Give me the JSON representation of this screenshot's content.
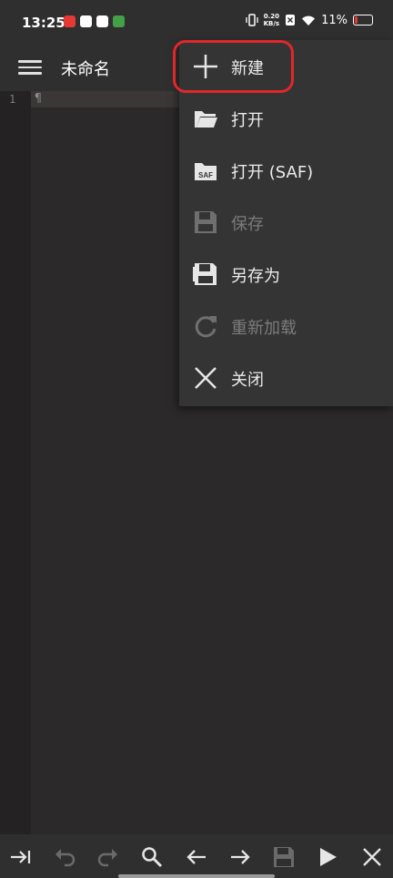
{
  "status_bar": {
    "time": "13:25",
    "net_speed_top": "0.20",
    "net_speed_bottom": "KB/s",
    "battery": "11%"
  },
  "app_bar": {
    "title": "未命名"
  },
  "editor": {
    "line_number": "1",
    "paragraph_mark": "¶"
  },
  "menu": {
    "items": [
      {
        "label": "新建",
        "icon": "plus-icon",
        "enabled": true
      },
      {
        "label": "打开",
        "icon": "folder-open-icon",
        "enabled": true
      },
      {
        "label": "打开 (SAF)",
        "icon": "saf-folder-icon",
        "enabled": true
      },
      {
        "label": "保存",
        "icon": "save-icon",
        "enabled": false
      },
      {
        "label": "另存为",
        "icon": "save-as-icon",
        "enabled": true
      },
      {
        "label": "重新加载",
        "icon": "reload-icon",
        "enabled": false
      },
      {
        "label": "关闭",
        "icon": "close-icon",
        "enabled": true
      }
    ]
  },
  "toolbar": {
    "icons": [
      "tab-indent-icon",
      "undo-icon",
      "redo-icon",
      "search-icon",
      "arrow-left-icon",
      "arrow-right-icon",
      "save-icon",
      "play-icon",
      "close-icon"
    ]
  },
  "colors": {
    "highlight": "#e0272b",
    "menu_bg": "#343434",
    "editor_bg": "#2b2929"
  }
}
